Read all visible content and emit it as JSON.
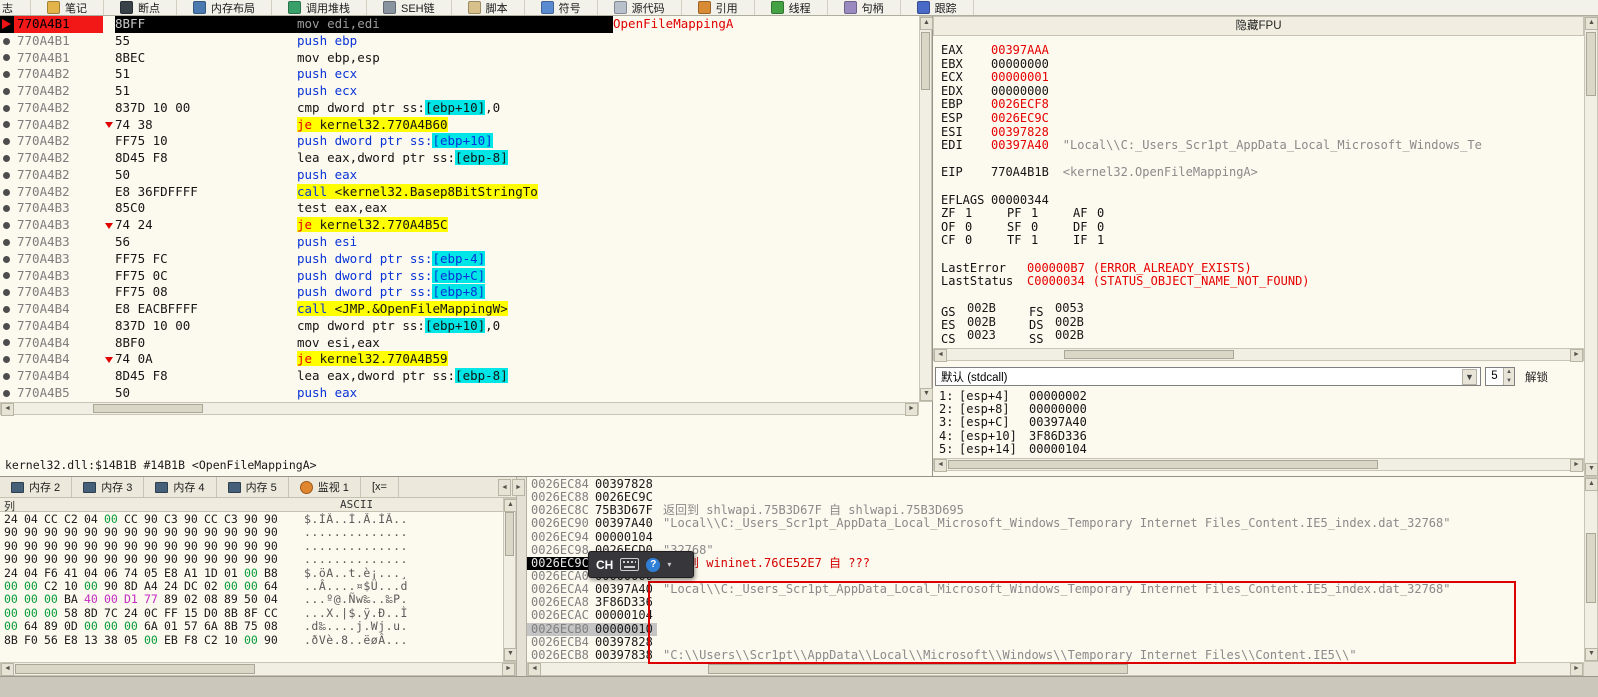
{
  "window": {
    "status_line": "kernel32.dll:$14B1B #14B1B <OpenFileMappingA>"
  },
  "toolbar": {
    "tabs": [
      {
        "id": "log",
        "label": "志"
      },
      {
        "id": "notes",
        "label": "笔记",
        "icon": "notes-icon",
        "color": "#E3B44A"
      },
      {
        "id": "breakpoints",
        "label": "断点",
        "icon": "breakpoints-icon",
        "color": "#384048"
      },
      {
        "id": "memory-map",
        "label": "内存布局",
        "icon": "memory-map-icon",
        "color": "#4A7AB0"
      },
      {
        "id": "call-stack",
        "label": "调用堆栈",
        "icon": "call-stack-icon",
        "color": "#3AA06A"
      },
      {
        "id": "seh-chain",
        "label": "SEH链",
        "icon": "seh-chain-icon",
        "color": "#8A94A0"
      },
      {
        "id": "script",
        "label": "脚本",
        "icon": "script-icon",
        "color": "#D8C08A"
      },
      {
        "id": "symbols",
        "label": "符号",
        "icon": "symbols-icon",
        "color": "#5A8AD0"
      },
      {
        "id": "source",
        "label": "源代码",
        "icon": "source-icon",
        "color": "#B8C0CC"
      },
      {
        "id": "references",
        "label": "引用",
        "icon": "references-icon",
        "color": "#D98A35"
      },
      {
        "id": "threads",
        "label": "线程",
        "icon": "threads-icon",
        "color": "#44A244"
      },
      {
        "id": "handles",
        "label": "句柄",
        "icon": "handles-icon",
        "color": "#9A8AC0"
      },
      {
        "id": "trace",
        "label": "跟踪",
        "icon": "trace-icon",
        "color": "#4A6AC8"
      }
    ]
  },
  "disasm": {
    "rows": [
      {
        "addr": "770A4B1",
        "bytes": "8BFF",
        "segs": [
          [
            "mov edi,edi",
            "gray"
          ]
        ],
        "comment": "OpenFileMappingA",
        "sel": true
      },
      {
        "addr": "770A4B1",
        "bytes": "55",
        "segs": [
          [
            "push ebp",
            "blue"
          ]
        ]
      },
      {
        "addr": "770A4B1",
        "bytes": "8BEC",
        "segs": [
          [
            "mov ebp,esp",
            "ins"
          ]
        ]
      },
      {
        "addr": "770A4B2",
        "bytes": "51",
        "segs": [
          [
            "push ecx",
            "blue"
          ]
        ]
      },
      {
        "addr": "770A4B2",
        "bytes": "51",
        "segs": [
          [
            "push ecx",
            "blue"
          ]
        ]
      },
      {
        "addr": "770A4B2",
        "bytes": "837D 10 00",
        "segs": [
          [
            "cmp dword ptr ss:",
            "ins"
          ],
          [
            "[ebp+10]",
            "ins",
            "cyan"
          ],
          [
            ",0",
            "ins"
          ]
        ]
      },
      {
        "addr": "770A4B2",
        "bytes": "74 38",
        "jump": true,
        "segs": [
          [
            "je ",
            "red",
            "yellow"
          ],
          [
            "kernel32.770A4B60",
            "ins",
            "yellow"
          ]
        ]
      },
      {
        "addr": "770A4B2",
        "bytes": "FF75 10",
        "segs": [
          [
            "push dword ptr ss:",
            "blue"
          ],
          [
            "[ebp+10]",
            "blue",
            "cyan"
          ]
        ]
      },
      {
        "addr": "770A4B2",
        "bytes": "8D45 F8",
        "segs": [
          [
            "lea eax,dword ptr ss:",
            "ins"
          ],
          [
            "[ebp-8]",
            "ins",
            "cyan"
          ]
        ]
      },
      {
        "addr": "770A4B2",
        "bytes": "50",
        "segs": [
          [
            "push eax",
            "blue"
          ]
        ]
      },
      {
        "addr": "770A4B2",
        "bytes": "E8 36FDFFFF",
        "segs": [
          [
            "call ",
            "blue",
            "yellow"
          ],
          [
            "<kernel32.Basep8BitStringTo",
            "ins",
            "yellow"
          ]
        ]
      },
      {
        "addr": "770A4B3",
        "bytes": "85C0",
        "segs": [
          [
            "test eax,eax",
            "ins"
          ]
        ]
      },
      {
        "addr": "770A4B3",
        "bytes": "74 24",
        "jump": true,
        "segs": [
          [
            "je ",
            "red",
            "yellow"
          ],
          [
            "kernel32.770A4B5C",
            "ins",
            "yellow"
          ]
        ]
      },
      {
        "addr": "770A4B3",
        "bytes": "56",
        "segs": [
          [
            "push esi",
            "blue"
          ]
        ]
      },
      {
        "addr": "770A4B3",
        "bytes": "FF75 FC",
        "segs": [
          [
            "push dword ptr ss:",
            "blue"
          ],
          [
            "[ebp-4]",
            "blue",
            "cyan"
          ]
        ]
      },
      {
        "addr": "770A4B3",
        "bytes": "FF75 0C",
        "segs": [
          [
            "push dword ptr ss:",
            "blue"
          ],
          [
            "[ebp+C]",
            "blue",
            "cyan"
          ]
        ]
      },
      {
        "addr": "770A4B3",
        "bytes": "FF75 08",
        "segs": [
          [
            "push dword ptr ss:",
            "blue"
          ],
          [
            "[ebp+8]",
            "blue",
            "cyan"
          ]
        ]
      },
      {
        "addr": "770A4B4",
        "bytes": "E8 EACBFFFF",
        "segs": [
          [
            "call ",
            "blue",
            "yellow"
          ],
          [
            "<JMP.&OpenFileMappingW>",
            "ins",
            "yellow"
          ]
        ]
      },
      {
        "addr": "770A4B4",
        "bytes": "837D 10 00",
        "segs": [
          [
            "cmp dword ptr ss:",
            "ins"
          ],
          [
            "[ebp+10]",
            "ins",
            "cyan"
          ],
          [
            ",0",
            "ins"
          ]
        ]
      },
      {
        "addr": "770A4B4",
        "bytes": "8BF0",
        "segs": [
          [
            "mov esi,eax",
            "ins"
          ]
        ]
      },
      {
        "addr": "770A4B4",
        "bytes": "74 0A",
        "jump": true,
        "segs": [
          [
            "je ",
            "red",
            "yellow"
          ],
          [
            "kernel32.770A4B59",
            "ins",
            "yellow"
          ]
        ]
      },
      {
        "addr": "770A4B4",
        "bytes": "8D45 F8",
        "segs": [
          [
            "lea eax,dword ptr ss:",
            "ins"
          ],
          [
            "[ebp-8]",
            "ins",
            "cyan"
          ]
        ]
      },
      {
        "addr": "770A4B5",
        "bytes": "50",
        "segs": [
          [
            "push eax",
            "blue"
          ]
        ]
      }
    ]
  },
  "registers": {
    "header": "隐藏FPU",
    "gpr": [
      [
        "EAX",
        "00397AAA",
        "red"
      ],
      [
        "EBX",
        "00000000",
        "blk"
      ],
      [
        "ECX",
        "00000001",
        "red"
      ],
      [
        "EDX",
        "00000000",
        "blk"
      ],
      [
        "EBP",
        "0026ECF8",
        "red"
      ],
      [
        "ESP",
        "0026EC9C",
        "red"
      ],
      [
        "ESI",
        "00397828",
        "red"
      ],
      [
        "EDI",
        "00397A40",
        "red",
        "\"Local\\\\C:_Users_Scr1pt_AppData_Local_Microsoft_Windows_Te"
      ]
    ],
    "eip": {
      "name": "EIP",
      "value": "770A4B1B",
      "symbol": "<kernel32.OpenFileMappingA>"
    },
    "eflags": {
      "name": "EFLAGS",
      "value": "00000344"
    },
    "flags": [
      [
        [
          "ZF",
          "1"
        ],
        [
          "PF",
          "1"
        ],
        [
          "AF",
          "0"
        ]
      ],
      [
        [
          "OF",
          "0"
        ],
        [
          "SF",
          "0"
        ],
        [
          "DF",
          "0"
        ]
      ],
      [
        [
          "CF",
          "0"
        ],
        [
          "TF",
          "1"
        ],
        [
          "IF",
          "1"
        ]
      ]
    ],
    "last": [
      [
        "LastError",
        "000000B7",
        "(ERROR_ALREADY_EXISTS)"
      ],
      [
        "LastStatus",
        "C0000034",
        "(STATUS_OBJECT_NAME_NOT_FOUND)"
      ]
    ],
    "segments": [
      [
        [
          "GS",
          "002B"
        ],
        [
          "FS",
          "0053"
        ]
      ],
      [
        [
          "ES",
          "002B"
        ],
        [
          "DS",
          "002B"
        ]
      ],
      [
        [
          "CS",
          "0023"
        ],
        [
          "SS",
          "002B"
        ]
      ]
    ]
  },
  "convention": {
    "value": "默认 (stdcall)",
    "count": "5",
    "lock_label": "解锁"
  },
  "args": {
    "rows": [
      [
        "1:",
        "[esp+4]",
        "00000002"
      ],
      [
        "2:",
        "[esp+8]",
        "00000000"
      ],
      [
        "3:",
        "[esp+C]",
        "00397A40"
      ],
      [
        "4:",
        "[esp+10]",
        "3F86D336"
      ],
      [
        "5:",
        "[esp+14]",
        "00000104"
      ]
    ]
  },
  "dump": {
    "tabs": [
      {
        "id": "dump-2",
        "label": "内存 2"
      },
      {
        "id": "dump-3",
        "label": "内存 3"
      },
      {
        "id": "dump-4",
        "label": "内存 4"
      },
      {
        "id": "dump-5",
        "label": "内存 5"
      },
      {
        "id": "watch-1",
        "label": "监视 1"
      },
      {
        "id": "locals",
        "label": "[x="
      }
    ],
    "header_left": "列",
    "header_ascii": "ASCII",
    "rows": [
      {
        "bytes": "24 04 CC C2 04 00 CC 90 C3 90 CC C3 90 90",
        "colors": "kkkkkgkkkkkkkk",
        "ascii": "$.ÌÂ..Ì.Ã.ÌÃ.."
      },
      {
        "bytes": "90 90 90 90 90 90 90 90 90 90 90 90 90 90",
        "colors": "kkkkkkkkkkkkkk",
        "ascii": ".............."
      },
      {
        "bytes": "90 90 90 90 90 90 90 90 90 90 90 90 90 90",
        "colors": "kkkkkkkkkkkkkk",
        "ascii": ".............."
      },
      {
        "bytes": "90 90 90 90 90 90 90 90 90 90 90 90 90 90",
        "colors": "kkkkkkkkkkkkkk",
        "ascii": ".............."
      },
      {
        "bytes": "24 04 F6 41 04 06 74 05 E8 A1 1D 01 00 B8",
        "colors": "kkkkkkkkkkkkgk",
        "ascii": "$.öA..t.è¡...¸"
      },
      {
        "bytes": "00 00 C2 10 00 90 8D A4 24 DC 02 00 00 64",
        "colors": "ggkkgkkkkkkggk",
        "ascii": "..Â....¤$Ü...d"
      },
      {
        "bytes": "00 00 00 BA 40 00 D1 77 89 02 08 89 50 04",
        "colors": "gggkmmmmkkkkkk",
        "ascii": "...º@.Ñw‰..‰P."
      },
      {
        "bytes": "00 00 00 58 8D 7C 24 0C FF 15 D0 8B 8F CC",
        "colors": "gggkkkkkkkkkkk",
        "ascii": "...X.|$.ÿ.Ð..Ì"
      },
      {
        "bytes": "00 64 89 0D 00 00 00 6A 01 57 6A 8B 75 08",
        "colors": "gkkkgggkkkkkkk",
        "ascii": ".d‰....j.Wj.u."
      },
      {
        "bytes": "8B F0 56 E8 13 38 05 00 EB F8 C2 10 00 90",
        "colors": "kkkkkkkgkkkkgk",
        "ascii": ".ðVè.8..ëøÂ..."
      }
    ]
  },
  "stack": {
    "rows": [
      {
        "addr": "0026EC84",
        "value": "00397828",
        "comment": "",
        "cls": ""
      },
      {
        "addr": "0026EC88",
        "value": "0026EC9C",
        "comment": "",
        "cls": ""
      },
      {
        "addr": "0026EC8C",
        "value": "75B3D67F",
        "comment": "返回到 shlwapi.75B3D67F 自 shlwapi.75B3D695",
        "cls": "gray"
      },
      {
        "addr": "0026EC90",
        "value": "00397A40",
        "comment": "\"Local\\\\C:_Users_Scr1pt_AppData_Local_Microsoft_Windows_Temporary Internet Files_Content.IE5_index.dat_32768\"",
        "cls": "gray"
      },
      {
        "addr": "0026EC94",
        "value": "00000104",
        "comment": "",
        "cls": ""
      },
      {
        "addr": "0026EC98",
        "value": "0026ECD0",
        "comment": "\"32768\"",
        "cls": "gray"
      },
      {
        "addr": "0026EC9C",
        "value": "76CE52E7",
        "comment": "返回到 wininet.76CE52E7 自 ???",
        "cls": "red",
        "row": "sel"
      },
      {
        "addr": "0026ECA0",
        "value": "00000000",
        "comment": "",
        "cls": ""
      },
      {
        "addr": "0026ECA4",
        "value": "00397A40",
        "comment": "\"Local\\\\C:_Users_Scr1pt_AppData_Local_Microsoft_Windows_Temporary Internet Files_Content.IE5_index.dat_32768\"",
        "cls": "gray"
      },
      {
        "addr": "0026ECA8",
        "value": "3F86D336",
        "comment": "",
        "cls": ""
      },
      {
        "addr": "0026ECAC",
        "value": "00000104",
        "comment": "",
        "cls": ""
      },
      {
        "addr": "0026ECB0",
        "value": "00000010",
        "comment": "",
        "cls": "",
        "row": "hl"
      },
      {
        "addr": "0026ECB4",
        "value": "00397828",
        "comment": "",
        "cls": ""
      },
      {
        "addr": "0026ECB8",
        "value": "00397838",
        "comment": "\"C:\\\\Users\\\\Scr1pt\\\\AppData\\\\Local\\\\Microsoft\\\\Windows\\\\Temporary Internet Files\\\\Content.IE5\\\\\"",
        "cls": "gray"
      }
    ]
  },
  "ime": {
    "label": "CH"
  }
}
